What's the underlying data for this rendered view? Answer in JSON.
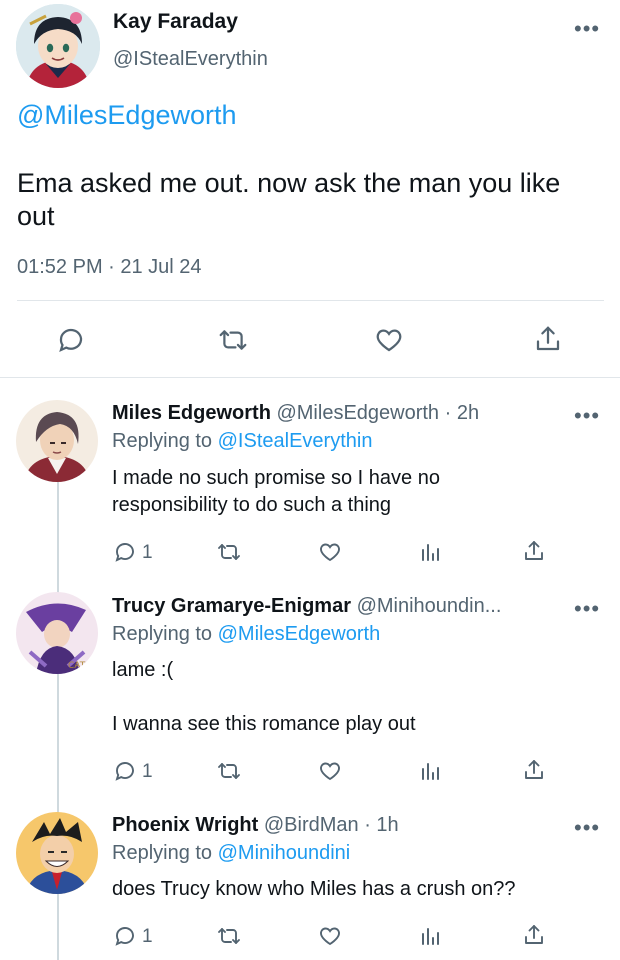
{
  "main": {
    "name": "Kay Faraday",
    "handle": "@IStealEverythin",
    "mention": "@MilesEdgeworth",
    "text": "Ema asked me out. now ask the man you like out",
    "timestamp": "01:52 PM · 21 Jul 24"
  },
  "colors": {
    "link": "#1d9bf0",
    "secondary": "#536471",
    "divider": "#cfd9de"
  },
  "replies": [
    {
      "name": "Miles Edgeworth",
      "meta": "@MilesEdgeworth · 2h",
      "replying_prefix": "Replying to",
      "replying_to": "@IStealEverythin",
      "text_lines": [
        "I made no such promise so I have no",
        "responsibility to do such a thing"
      ],
      "reply_count": "1"
    },
    {
      "name": "Trucy Gramarye-Enigmar",
      "meta": "@Minihoundin...",
      "replying_prefix": "Replying to",
      "replying_to": "@MilesEdgeworth",
      "text_lines": [
        "lame :(",
        "I wanna see this romance play out"
      ],
      "reply_count": "1"
    },
    {
      "name": "Phoenix Wright",
      "meta": "@BirdMan · 1h",
      "replying_prefix": "Replying to",
      "replying_to": "@Minihoundini",
      "text_lines": [
        "does Trucy know who Miles has a crush on??"
      ],
      "reply_count": "1"
    }
  ],
  "icons": {
    "reply": "reply-bubble-icon",
    "retweet": "retweet-icon",
    "like": "heart-icon",
    "share": "share-icon",
    "analytics": "analytics-icon",
    "more": "more-dots-icon"
  }
}
